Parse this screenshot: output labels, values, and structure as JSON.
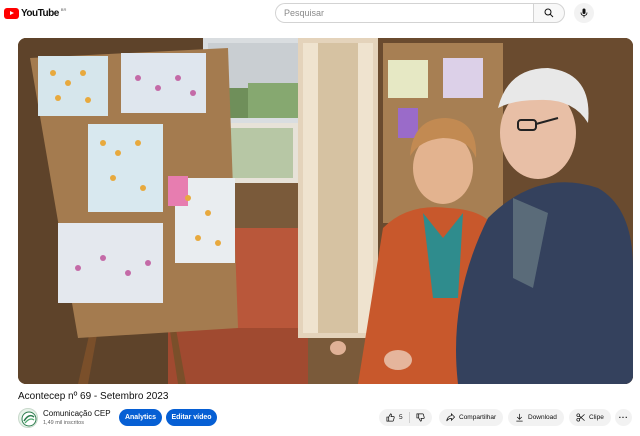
{
  "header": {
    "logo_text": "YouTube",
    "region": "BR",
    "search_placeholder": "Pesquisar"
  },
  "video": {
    "title": "Acontecep nº 69 - Setembro 2023"
  },
  "channel": {
    "name": "Comunicação CEP",
    "subscribers": "1,49 mil inscritos",
    "analytics_label": "Analytics",
    "edit_label": "Editar vídeo"
  },
  "actions": {
    "likes": "5",
    "share_label": "Compartilhar",
    "download_label": "Download",
    "clip_label": "Clipe",
    "more_label": "···"
  },
  "colors": {
    "brand_red": "#ff0000",
    "accent_blue": "#065fd4",
    "pill_bg": "#f2f2f2"
  }
}
